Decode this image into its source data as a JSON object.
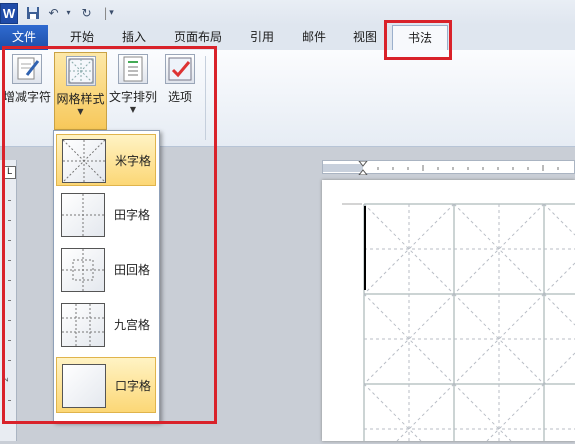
{
  "app": {
    "logo_letter": "W"
  },
  "tabs": [
    "文件",
    "开始",
    "插入",
    "页面布局",
    "引用",
    "邮件",
    "视图",
    "书法"
  ],
  "ribbon": {
    "buttons": [
      "增减字符",
      "网格样式",
      "文字排列",
      "选项"
    ]
  },
  "grid_styles": [
    "米字格",
    "田字格",
    "田回格",
    "九宫格",
    "口字格"
  ],
  "ruler": {
    "v_mark": "2",
    "corner": "L"
  },
  "colors": {
    "annotation_red": "#d9222a",
    "selected": "#fcd776",
    "file_tab": "#1d4fa8"
  }
}
